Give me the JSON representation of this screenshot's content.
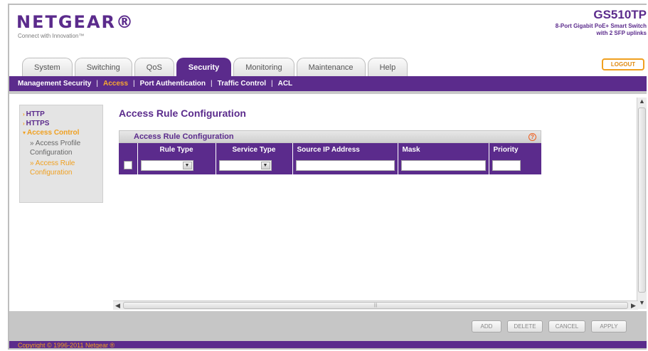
{
  "header": {
    "logo": "NETGEAR®",
    "tagline": "Connect with Innovation™",
    "model": "GS510TP",
    "model_desc_line1": "8-Port Gigabit PoE+ Smart Switch",
    "model_desc_line2": "with 2 SFP uplinks",
    "logout_label": "LOGOUT"
  },
  "tabs": [
    {
      "label": "System"
    },
    {
      "label": "Switching"
    },
    {
      "label": "QoS"
    },
    {
      "label": "Security",
      "active": true
    },
    {
      "label": "Monitoring"
    },
    {
      "label": "Maintenance"
    },
    {
      "label": "Help"
    }
  ],
  "subnav": [
    {
      "label": "Management Security"
    },
    {
      "label": "Access",
      "active": true
    },
    {
      "label": "Port Authentication"
    },
    {
      "label": "Traffic Control"
    },
    {
      "label": "ACL"
    }
  ],
  "sidebar": {
    "http": "HTTP",
    "https": "HTTPS",
    "access_control": "Access Control",
    "access_profile": "» Access Profile Configuration",
    "access_rule": "» Access Rule Configuration"
  },
  "main": {
    "page_title": "Access Rule Configuration",
    "panel_title": "Access Rule Configuration",
    "help_icon": "help-icon",
    "columns": {
      "rule_type": "Rule Type",
      "service_type": "Service Type",
      "source_ip": "Source IP Address",
      "mask": "Mask",
      "priority": "Priority"
    },
    "row": {
      "rule_type_value": "",
      "service_type_value": "",
      "source_ip_value": "",
      "mask_value": "",
      "priority_value": ""
    }
  },
  "buttons": {
    "add": "ADD",
    "delete": "DELETE",
    "cancel": "CANCEL",
    "apply": "APPLY"
  },
  "footer": {
    "copyright": "Copyright © 1996-2011 Netgear ®"
  },
  "colors": {
    "brand_purple": "#5b2b8c",
    "accent_orange": "#f0a020"
  }
}
